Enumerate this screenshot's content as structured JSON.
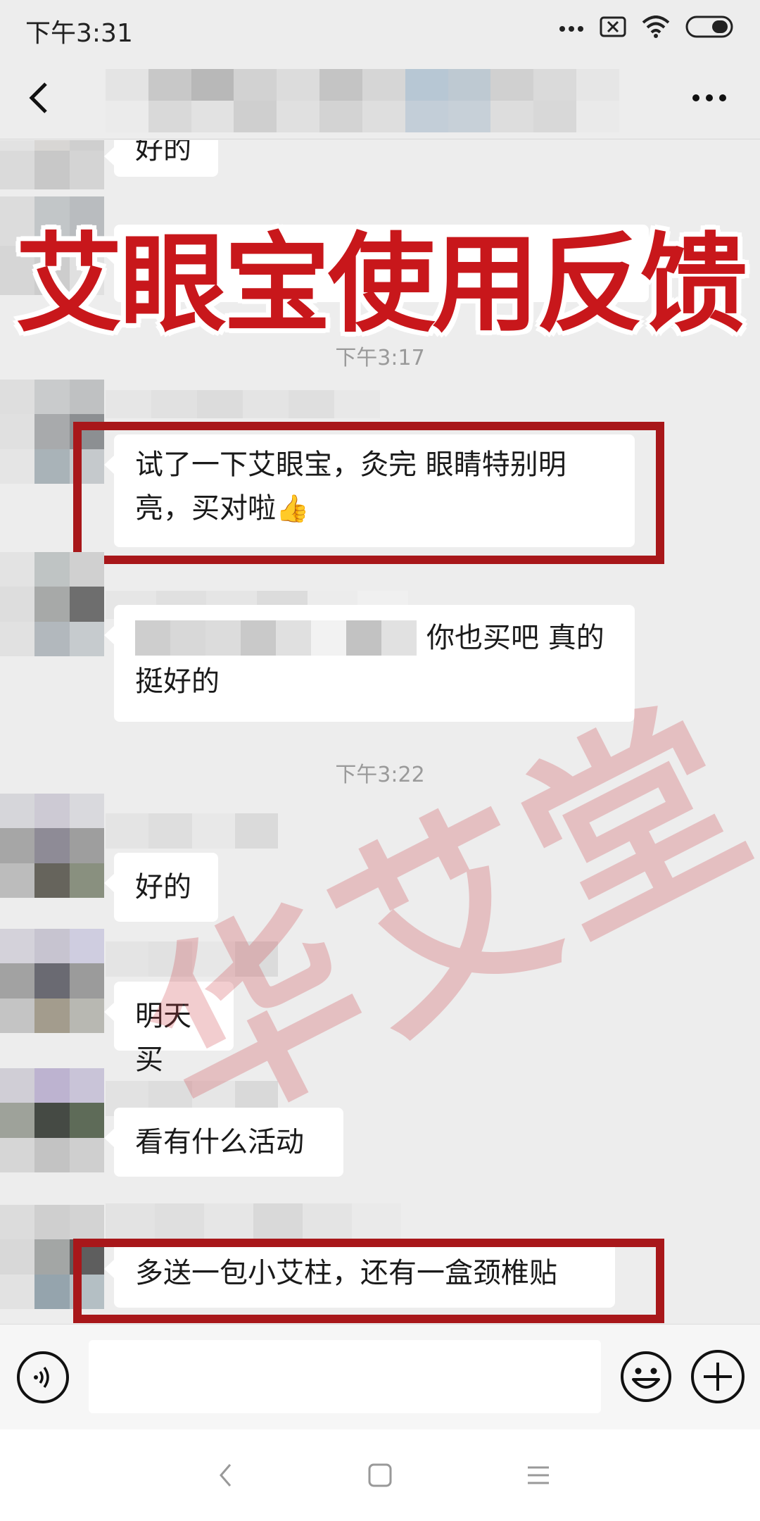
{
  "status_bar": {
    "time": "下午3:31",
    "icons": [
      "more-dots-icon",
      "sim-blocked-icon",
      "wifi-icon",
      "battery-icon"
    ]
  },
  "header": {
    "title": "",
    "back_icon": "chevron-left-icon",
    "more_icon": "more-horizontal-icon"
  },
  "overlay": {
    "title": "艾眼宝使用反馈",
    "watermark": "华艾堂",
    "highlight_color": "#a8171a",
    "title_color": "#c8171b"
  },
  "messages": {
    "partial_top": "好的",
    "time_1": "下午3:17",
    "msg_1_line1": "试了一下艾眼宝，灸完 眼睛特别明",
    "msg_1_line2": "亮，买对啦",
    "msg_1_emoji": "👍",
    "msg_2_line1": "你也买吧 真的",
    "msg_2_line2": "挺好的",
    "time_2": "下午3:22",
    "msg_3": "好的",
    "msg_4": "明天买",
    "msg_5": "看有什么活动",
    "msg_6": "多送一包小艾柱，还有一盒颈椎贴"
  },
  "input_bar": {
    "voice_icon": "voice-icon",
    "message_value": "",
    "emoji_icon": "smiley-icon",
    "plus_icon": "plus-circle-icon"
  },
  "nav_bar": {
    "icons": [
      "nav-back-icon",
      "nav-home-icon",
      "nav-menu-icon"
    ]
  }
}
